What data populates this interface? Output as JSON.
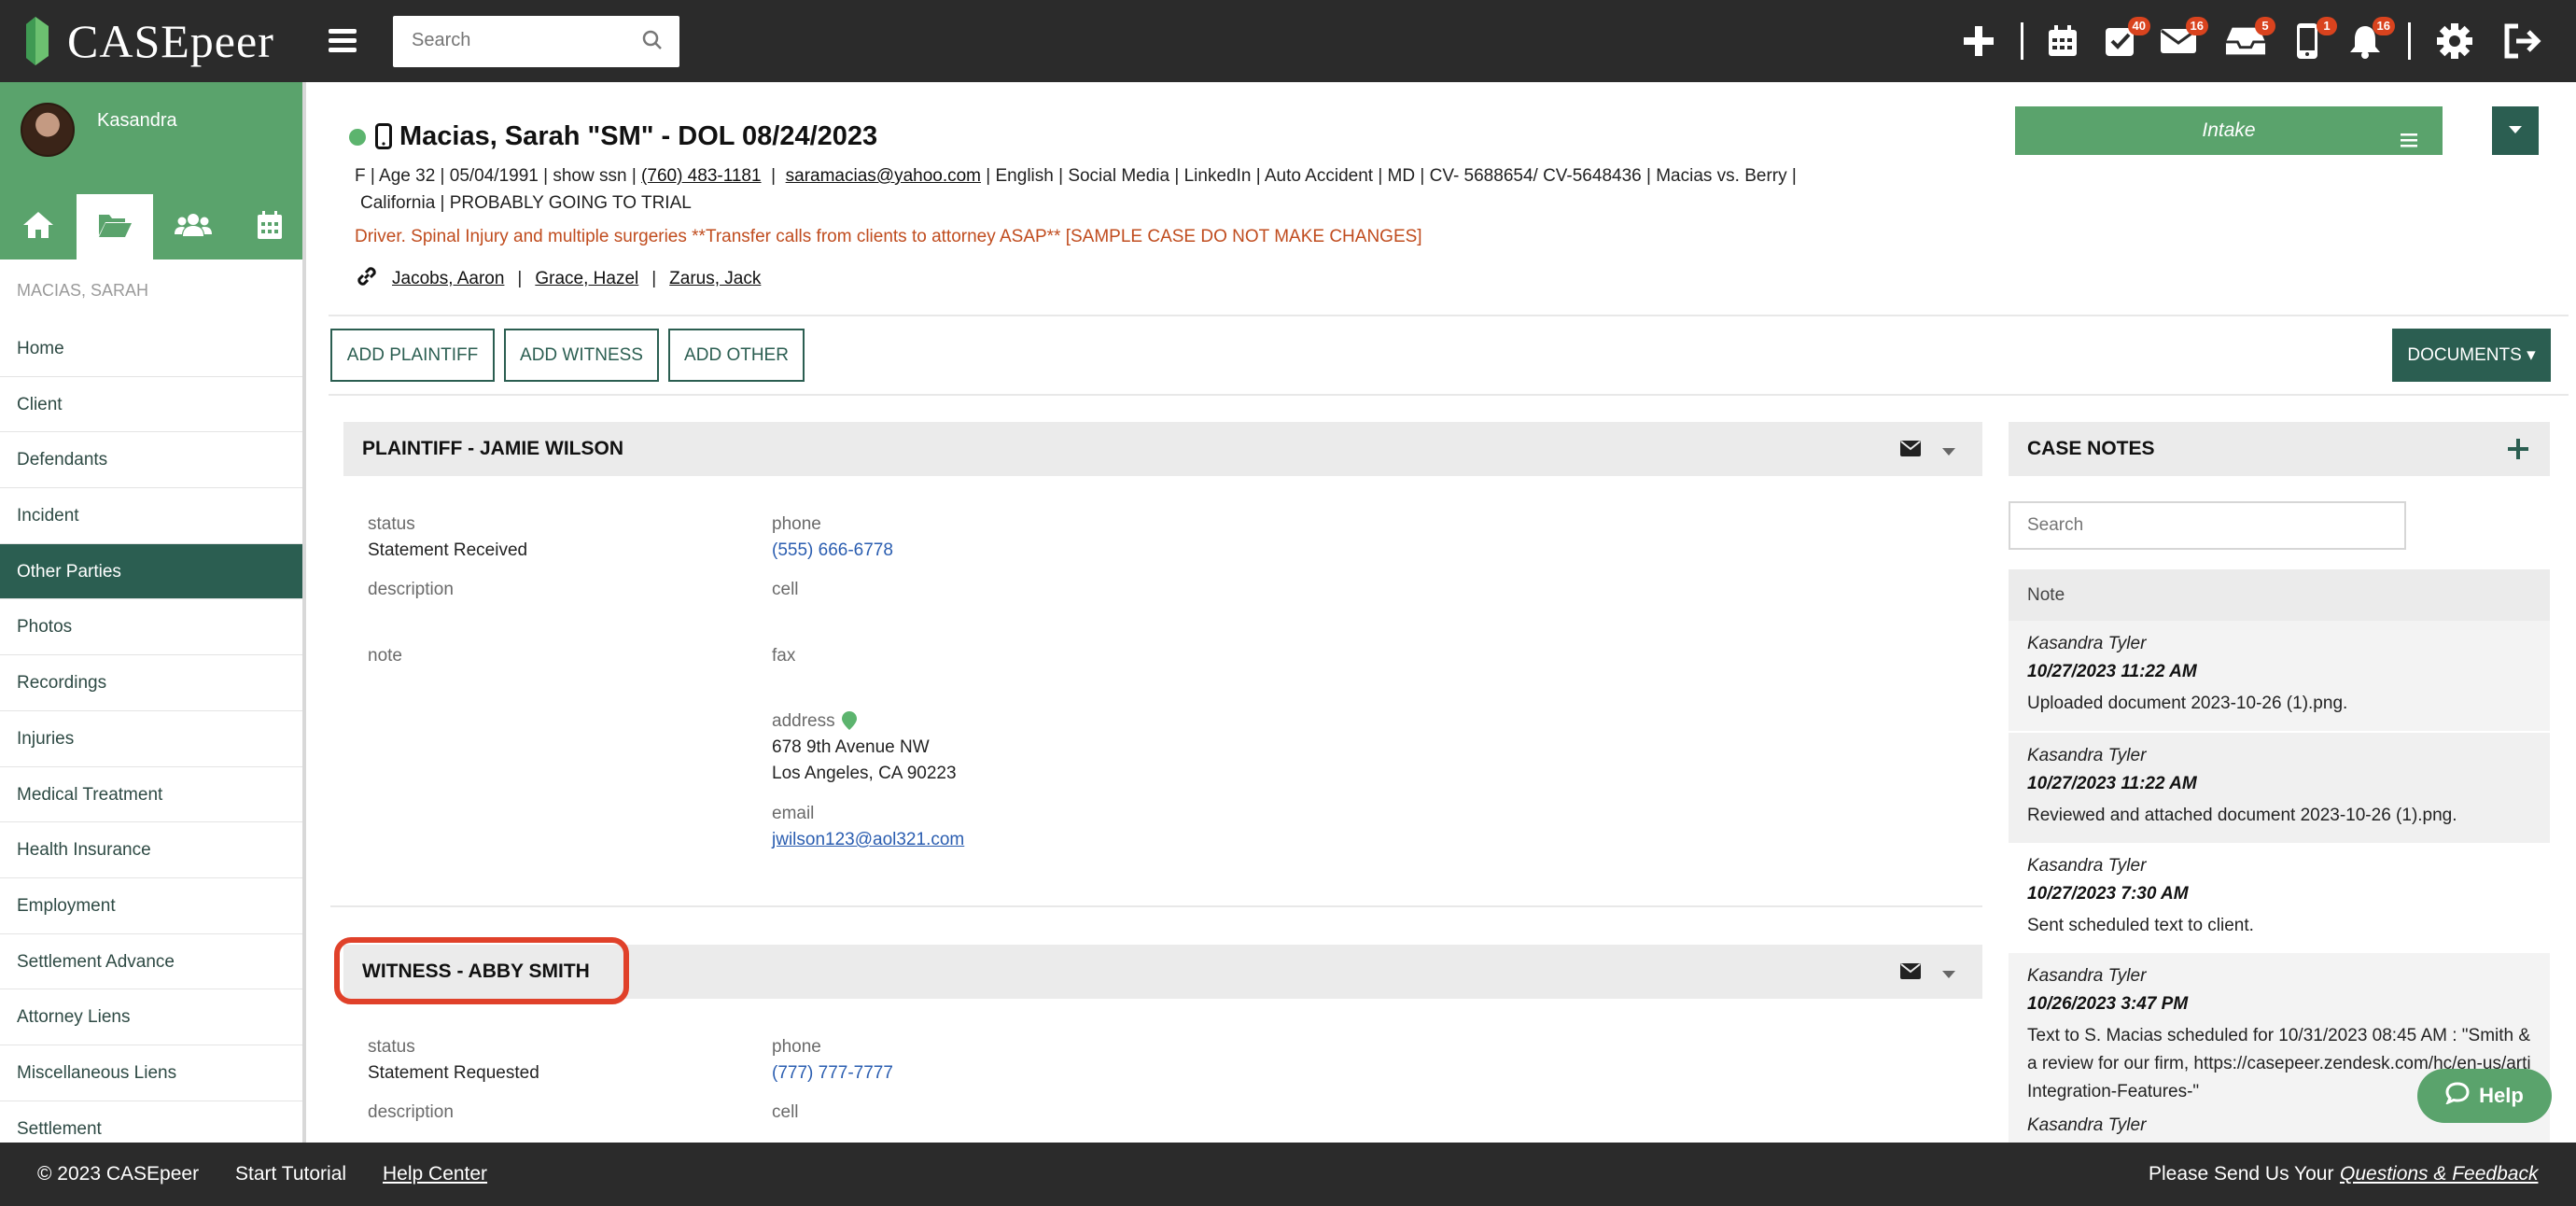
{
  "app": {
    "name": "CASEpeer"
  },
  "header": {
    "search_placeholder": "Search",
    "badges": {
      "tasks": "40",
      "mail": "16",
      "inbox": "5",
      "phone": "1",
      "notifications": "16"
    }
  },
  "sidebar": {
    "user_name": "Kasandra",
    "case_label": "MACIAS, SARAH",
    "items": [
      "Home",
      "Client",
      "Defendants",
      "Incident",
      "Other Parties",
      "Photos",
      "Recordings",
      "Injuries",
      "Medical Treatment",
      "Health Insurance",
      "Employment",
      "Settlement Advance",
      "Attorney Liens",
      "Miscellaneous Liens",
      "Settlement"
    ],
    "active_item": "Other Parties"
  },
  "case": {
    "title": "Macias, Sarah \"SM\" - DOL 08/24/2023",
    "meta1_pre": "F  |  Age 32   |  05/04/1991  |  show ssn  |",
    "phone": "(760) 483-1181",
    "email": "saramacias@yahoo.com",
    "meta1_post": "|  English  |  Social Media  |  LinkedIn  |  Auto Accident  |  MD  |  CV- 5688654/ CV-5648436  |  Macias vs. Berry  |",
    "meta2": "California  |  PROBABLY GOING TO TRIAL",
    "warning": "Driver. Spinal Injury and multiple surgeries **Transfer calls from clients to attorney ASAP** [SAMPLE CASE DO NOT MAKE CHANGES]",
    "staff": [
      "Jacobs, Aaron",
      "Grace, Hazel",
      "Zarus, Jack"
    ],
    "stage": "Intake"
  },
  "actions": {
    "add_plaintiff": "ADD PLAINTIFF",
    "add_witness": "ADD WITNESS",
    "add_other": "ADD OTHER",
    "documents": "DOCUMENTS ▾"
  },
  "plaintiff": {
    "title": "PLAINTIFF - JAMIE WILSON",
    "status_label": "status",
    "status": "Statement Received",
    "description_label": "description",
    "note_label": "note",
    "phone_label": "phone",
    "phone": "(555) 666-6778",
    "cell_label": "cell",
    "fax_label": "fax",
    "address_label": "address",
    "address1": "678 9th Avenue NW",
    "address2": "Los Angeles, CA 90223",
    "email_label": "email",
    "email": "jwilson123@aol321.com"
  },
  "witness": {
    "title": "WITNESS - ABBY SMITH",
    "status_label": "status",
    "status": "Statement Requested",
    "description_label": "description",
    "phone_label": "phone",
    "phone": "(777) 777-7777",
    "cell_label": "cell"
  },
  "notes": {
    "title": "CASE NOTES",
    "search_placeholder": "Search",
    "column": "Note",
    "items": [
      {
        "author": "Kasandra Tyler",
        "date": "10/27/2023 11:22 AM",
        "text": "Uploaded document 2023-10-26 (1).png."
      },
      {
        "author": "Kasandra Tyler",
        "date": "10/27/2023 11:22 AM",
        "text": "Reviewed and attached document 2023-10-26 (1).png."
      },
      {
        "author": "Kasandra Tyler",
        "date": "10/27/2023 7:30 AM",
        "text": "Sent scheduled text to client."
      },
      {
        "author": "Kasandra Tyler",
        "date": "10/26/2023 3:47 PM",
        "text": "Text to S. Macias scheduled for 10/31/2023 08:45 AM : \"Smith &",
        "text2": "a review for our firm, https://casepeer.zendesk.com/hc/en-us/arti",
        "text3": "Integration-Features-\""
      }
    ],
    "partial_author": "Kasandra Tyler"
  },
  "help": "Help",
  "footer": {
    "copyright": "© 2023 CASEpeer",
    "tutorial": "Start Tutorial",
    "help_center": "Help Center",
    "feedback_pre": "Please Send Us Your",
    "feedback_link": "Questions & Feedback"
  },
  "colors": {
    "topbar": "#2b2b2b",
    "brand_green": "#5aa36c",
    "dark_green": "#2b5e51",
    "badge": "#d9431e",
    "warning": "#c04c1e",
    "highlight": "#e0412a"
  }
}
